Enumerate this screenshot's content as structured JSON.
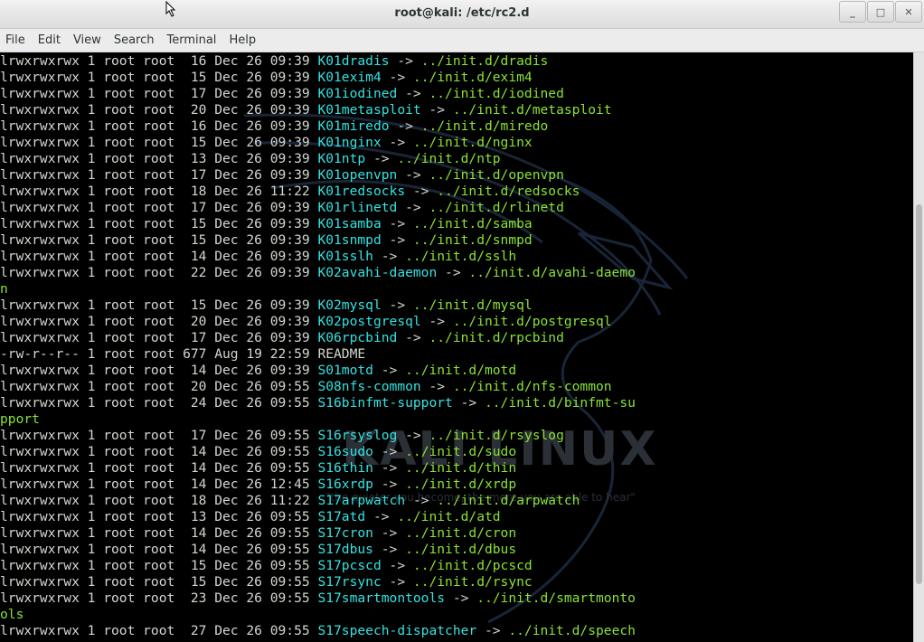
{
  "window": {
    "title": "root@kali: /etc/rc2.d",
    "min_symbol": "_",
    "max_symbol": "□",
    "close_symbol": "✕"
  },
  "menu": [
    "File",
    "Edit",
    "View",
    "Search",
    "Terminal",
    "Help"
  ],
  "watermark": {
    "logo_text": "KALI LINUX",
    "tagline": "\"the quieter you become, the more you are able to hear\""
  },
  "colors": {
    "link_name": "#34e2e2",
    "link_target": "#8ae234",
    "text": "#d3d7cf",
    "background": "#000000"
  },
  "terminal": {
    "lines": [
      {
        "meta": "lrwxrwxrwx 1 root root  16 Dec 26 09:39 ",
        "name": "K01dradis",
        "arrow": " -> ",
        "target": "../init.d/dradis"
      },
      {
        "meta": "lrwxrwxrwx 1 root root  15 Dec 26 09:39 ",
        "name": "K01exim4",
        "arrow": " -> ",
        "target": "../init.d/exim4"
      },
      {
        "meta": "lrwxrwxrwx 1 root root  17 Dec 26 09:39 ",
        "name": "K01iodined",
        "arrow": " -> ",
        "target": "../init.d/iodined"
      },
      {
        "meta": "lrwxrwxrwx 1 root root  20 Dec 26 09:39 ",
        "name": "K01metasploit",
        "arrow": " -> ",
        "target": "../init.d/metasploit"
      },
      {
        "meta": "lrwxrwxrwx 1 root root  16 Dec 26 09:39 ",
        "name": "K01miredo",
        "arrow": " -> ",
        "target": "../init.d/miredo"
      },
      {
        "meta": "lrwxrwxrwx 1 root root  15 Dec 26 09:39 ",
        "name": "K01nginx",
        "arrow": " -> ",
        "target": "../init.d/nginx"
      },
      {
        "meta": "lrwxrwxrwx 1 root root  13 Dec 26 09:39 ",
        "name": "K01ntp",
        "arrow": " -> ",
        "target": "../init.d/ntp"
      },
      {
        "meta": "lrwxrwxrwx 1 root root  17 Dec 26 09:39 ",
        "name": "K01openvpn",
        "arrow": " -> ",
        "target": "../init.d/openvpn"
      },
      {
        "meta": "lrwxrwxrwx 1 root root  18 Dec 26 11:22 ",
        "name": "K01redsocks",
        "arrow": " -> ",
        "target": "../init.d/redsocks"
      },
      {
        "meta": "lrwxrwxrwx 1 root root  17 Dec 26 09:39 ",
        "name": "K01rlinetd",
        "arrow": " -> ",
        "target": "../init.d/rlinetd"
      },
      {
        "meta": "lrwxrwxrwx 1 root root  15 Dec 26 09:39 ",
        "name": "K01samba",
        "arrow": " -> ",
        "target": "../init.d/samba"
      },
      {
        "meta": "lrwxrwxrwx 1 root root  15 Dec 26 09:39 ",
        "name": "K01snmpd",
        "arrow": " -> ",
        "target": "../init.d/snmpd"
      },
      {
        "meta": "lrwxrwxrwx 1 root root  14 Dec 26 09:39 ",
        "name": "K01sslh",
        "arrow": " -> ",
        "target": "../init.d/sslh"
      },
      {
        "meta": "lrwxrwxrwx 1 root root  22 Dec 26 09:39 ",
        "name": "K02avahi-daemon",
        "arrow": " -> ",
        "target": "../init.d/avahi-daemo"
      },
      {
        "meta": "",
        "name": "",
        "arrow": "",
        "target": "n"
      },
      {
        "meta": "lrwxrwxrwx 1 root root  15 Dec 26 09:39 ",
        "name": "K02mysql",
        "arrow": " -> ",
        "target": "../init.d/mysql"
      },
      {
        "meta": "lrwxrwxrwx 1 root root  20 Dec 26 09:39 ",
        "name": "K02postgresql",
        "arrow": " -> ",
        "target": "../init.d/postgresql"
      },
      {
        "meta": "lrwxrwxrwx 1 root root  17 Dec 26 09:39 ",
        "name": "K06rpcbind",
        "arrow": " -> ",
        "target": "../init.d/rpcbind"
      },
      {
        "meta": "-rw-r--r-- 1 root root 677 Aug 19 22:59 ",
        "name": "",
        "arrow": "",
        "target": "",
        "plain": "README"
      },
      {
        "meta": "lrwxrwxrwx 1 root root  14 Dec 26 09:39 ",
        "name": "S01motd",
        "arrow": " -> ",
        "target": "../init.d/motd"
      },
      {
        "meta": "lrwxrwxrwx 1 root root  20 Dec 26 09:55 ",
        "name": "S08nfs-common",
        "arrow": " -> ",
        "target": "../init.d/nfs-common"
      },
      {
        "meta": "lrwxrwxrwx 1 root root  24 Dec 26 09:55 ",
        "name": "S16binfmt-support",
        "arrow": " -> ",
        "target": "../init.d/binfmt-su"
      },
      {
        "meta": "",
        "name": "",
        "arrow": "",
        "target": "pport"
      },
      {
        "meta": "lrwxrwxrwx 1 root root  17 Dec 26 09:55 ",
        "name": "S16rsyslog",
        "arrow": " -> ",
        "target": "../init.d/rsyslog"
      },
      {
        "meta": "lrwxrwxrwx 1 root root  14 Dec 26 09:55 ",
        "name": "S16sudo",
        "arrow": " -> ",
        "target": "../init.d/sudo"
      },
      {
        "meta": "lrwxrwxrwx 1 root root  14 Dec 26 09:55 ",
        "name": "S16thin",
        "arrow": " -> ",
        "target": "../init.d/thin"
      },
      {
        "meta": "lrwxrwxrwx 1 root root  14 Dec 26 12:45 ",
        "name": "S16xrdp",
        "arrow": " -> ",
        "target": "../init.d/xrdp"
      },
      {
        "meta": "lrwxrwxrwx 1 root root  18 Dec 26 11:22 ",
        "name": "S17arpwatch",
        "arrow": " -> ",
        "target": "../init.d/arpwatch"
      },
      {
        "meta": "lrwxrwxrwx 1 root root  13 Dec 26 09:55 ",
        "name": "S17atd",
        "arrow": " -> ",
        "target": "../init.d/atd"
      },
      {
        "meta": "lrwxrwxrwx 1 root root  14 Dec 26 09:55 ",
        "name": "S17cron",
        "arrow": " -> ",
        "target": "../init.d/cron"
      },
      {
        "meta": "lrwxrwxrwx 1 root root  14 Dec 26 09:55 ",
        "name": "S17dbus",
        "arrow": " -> ",
        "target": "../init.d/dbus"
      },
      {
        "meta": "lrwxrwxrwx 1 root root  15 Dec 26 09:55 ",
        "name": "S17pcscd",
        "arrow": " -> ",
        "target": "../init.d/pcscd"
      },
      {
        "meta": "lrwxrwxrwx 1 root root  15 Dec 26 09:55 ",
        "name": "S17rsync",
        "arrow": " -> ",
        "target": "../init.d/rsync"
      },
      {
        "meta": "lrwxrwxrwx 1 root root  23 Dec 26 09:55 ",
        "name": "S17smartmontools",
        "arrow": " -> ",
        "target": "../init.d/smartmonto"
      },
      {
        "meta": "",
        "name": "",
        "arrow": "",
        "target": "ols"
      },
      {
        "meta": "lrwxrwxrwx 1 root root  27 Dec 26 09:55 ",
        "name": "S17speech-dispatcher",
        "arrow": " -> ",
        "target": "../init.d/speech"
      }
    ]
  }
}
